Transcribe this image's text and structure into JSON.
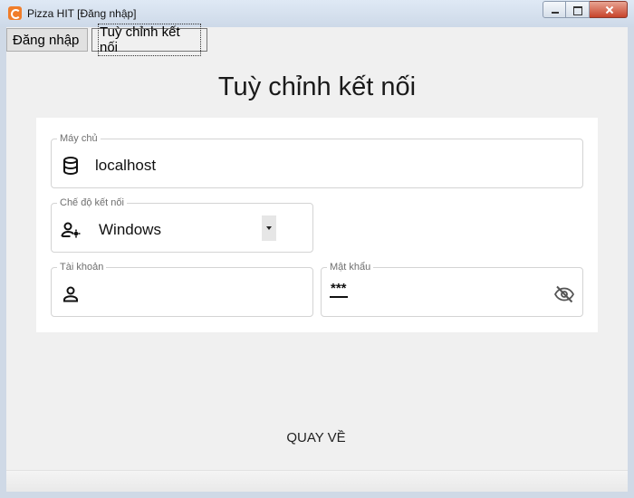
{
  "window": {
    "title": "Pizza HIT [Đăng nhập]"
  },
  "tabs": [
    {
      "label": "Đăng nhập"
    },
    {
      "label": "Tuỳ chỉnh kết nối"
    }
  ],
  "page": {
    "title": "Tuỳ chỉnh kết nối"
  },
  "form": {
    "server": {
      "label": "Máy chủ",
      "value": "localhost",
      "icon": "database-icon"
    },
    "mode": {
      "label": "Chế độ kết nối",
      "value": "Windows",
      "icon": "user-settings-icon"
    },
    "account": {
      "label": "Tài khoản",
      "value": "",
      "icon": "person-icon"
    },
    "password": {
      "label": "Mật khẩu",
      "value": "***",
      "icon": "password-icon",
      "toggle_icon": "eye-off-icon"
    }
  },
  "actions": {
    "back_label": "QUAY VỀ"
  }
}
